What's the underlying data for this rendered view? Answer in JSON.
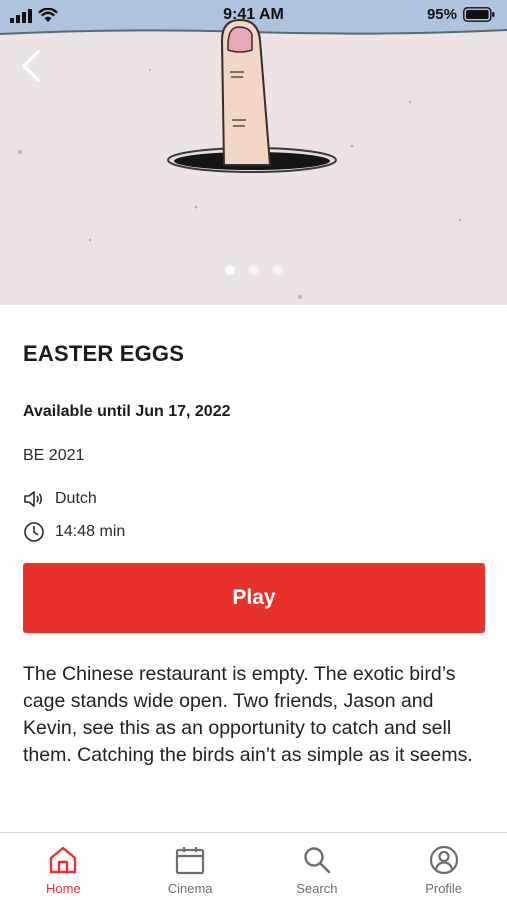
{
  "status_bar": {
    "time": "9:41 AM",
    "battery": "95%"
  },
  "hero": {
    "slide_count": 3,
    "active_slide": 0
  },
  "detail": {
    "title": "EASTER EGGS",
    "availability": "Available until Jun 17, 2022",
    "origin": "BE 2021",
    "language": "Dutch",
    "duration": "14:48 min",
    "play_label": "Play",
    "description": "The Chinese restaurant is empty. The exotic bird’s cage stands wide open. Two friends, Jason and Kevin, see this as an opportunity to catch and sell them. Catching the birds ain’t as simple as it seems."
  },
  "tabs": [
    {
      "label": "Home",
      "icon": "home-icon",
      "active": true
    },
    {
      "label": "Cinema",
      "icon": "calendar-icon",
      "active": false
    },
    {
      "label": "Search",
      "icon": "search-icon",
      "active": false
    },
    {
      "label": "Profile",
      "icon": "profile-icon",
      "active": false
    }
  ],
  "colors": {
    "accent": "#e6322b",
    "inactive_tab": "#6e6e6e"
  }
}
